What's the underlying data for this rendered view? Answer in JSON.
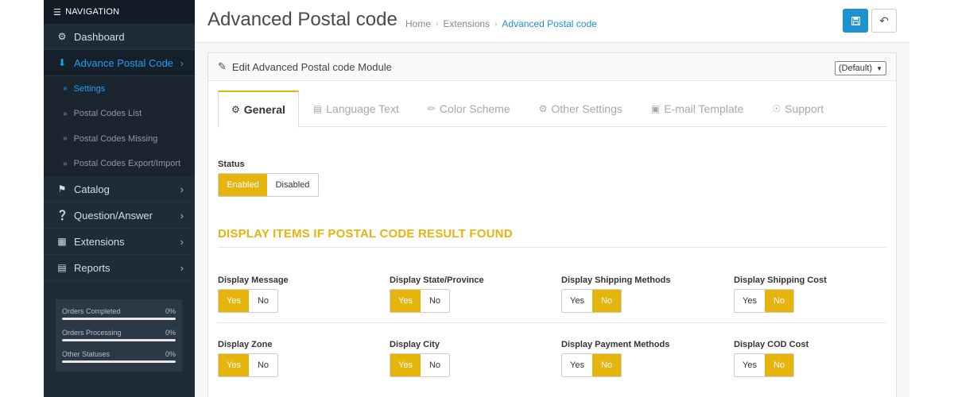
{
  "sidebar": {
    "header": "NAVIGATION",
    "items": [
      {
        "label": "Dashboard"
      },
      {
        "label": "Advance Postal Code"
      },
      {
        "label": "Catalog"
      },
      {
        "label": "Question/Answer"
      },
      {
        "label": "Extensions"
      },
      {
        "label": "Reports"
      }
    ],
    "subitems": [
      {
        "label": "Settings"
      },
      {
        "label": "Postal Codes List"
      },
      {
        "label": "Postal Codes Missing"
      },
      {
        "label": "Postal Codes Export/Import"
      }
    ],
    "stats": [
      {
        "label": "Orders Completed",
        "percent": "0%"
      },
      {
        "label": "Orders Processing",
        "percent": "0%"
      },
      {
        "label": "Other Statuses",
        "percent": "0%"
      }
    ]
  },
  "header": {
    "title": "Advanced Postal code",
    "breadcrumb": [
      "Home",
      "Extensions",
      "Advanced Postal code"
    ]
  },
  "panel": {
    "title": "Edit Advanced Postal code Module",
    "store_select": "(Default)"
  },
  "tabs": [
    {
      "label": "General"
    },
    {
      "label": "Language Text"
    },
    {
      "label": "Color Scheme"
    },
    {
      "label": "Other Settings"
    },
    {
      "label": "E-mail Template"
    },
    {
      "label": "Support"
    }
  ],
  "status": {
    "label": "Status",
    "enabled": "Enabled",
    "disabled": "Disabled"
  },
  "section_title": "DISPLAY ITEMS IF POSTAL CODE RESULT FOUND",
  "options": {
    "yes": "Yes",
    "no": "No"
  },
  "fields": [
    {
      "label": "Display Message",
      "value": "Yes"
    },
    {
      "label": "Display State/Province",
      "value": "Yes"
    },
    {
      "label": "Display Shipping Methods",
      "value": "No"
    },
    {
      "label": "Display Shipping Cost",
      "value": "No"
    },
    {
      "label": "Display Zone",
      "value": "Yes"
    },
    {
      "label": "Display City",
      "value": "Yes"
    },
    {
      "label": "Display Payment Methods",
      "value": "No"
    },
    {
      "label": "Display COD Cost",
      "value": "No"
    }
  ],
  "colors": {
    "accent": "#e5b40d",
    "primary": "#1e91cf",
    "link": "#1da1f2",
    "sidebar_bg": "#1e2b38"
  }
}
